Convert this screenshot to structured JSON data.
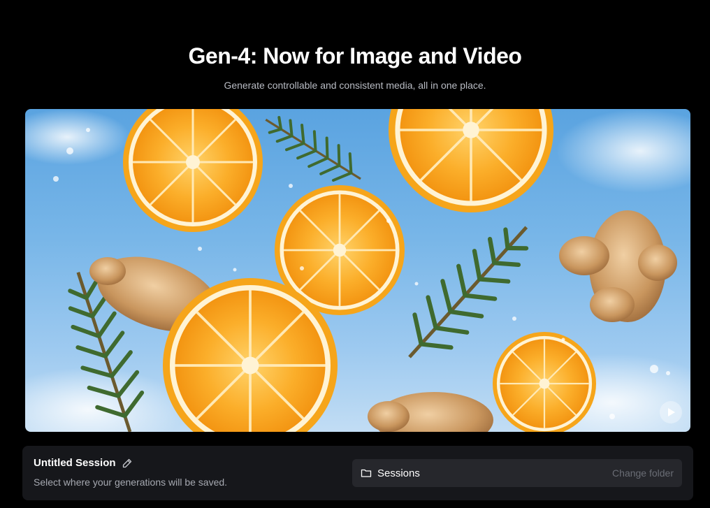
{
  "hero": {
    "title": "Gen-4: Now for Image and Video",
    "subtitle": "Generate controllable and consistent media, all in one place."
  },
  "media": {
    "play_icon": "play-icon"
  },
  "session": {
    "name": "Untitled Session",
    "edit_icon": "pencil-icon",
    "hint": "Select where your generations will be saved.",
    "folder_icon": "folder-icon",
    "folder_label": "Sessions",
    "change_folder_label": "Change folder"
  },
  "colors": {
    "background": "#000000",
    "panel": "#16171b",
    "folder_field": "#26272c",
    "orange": "#f7a21b",
    "sky": "#78b6e8"
  }
}
